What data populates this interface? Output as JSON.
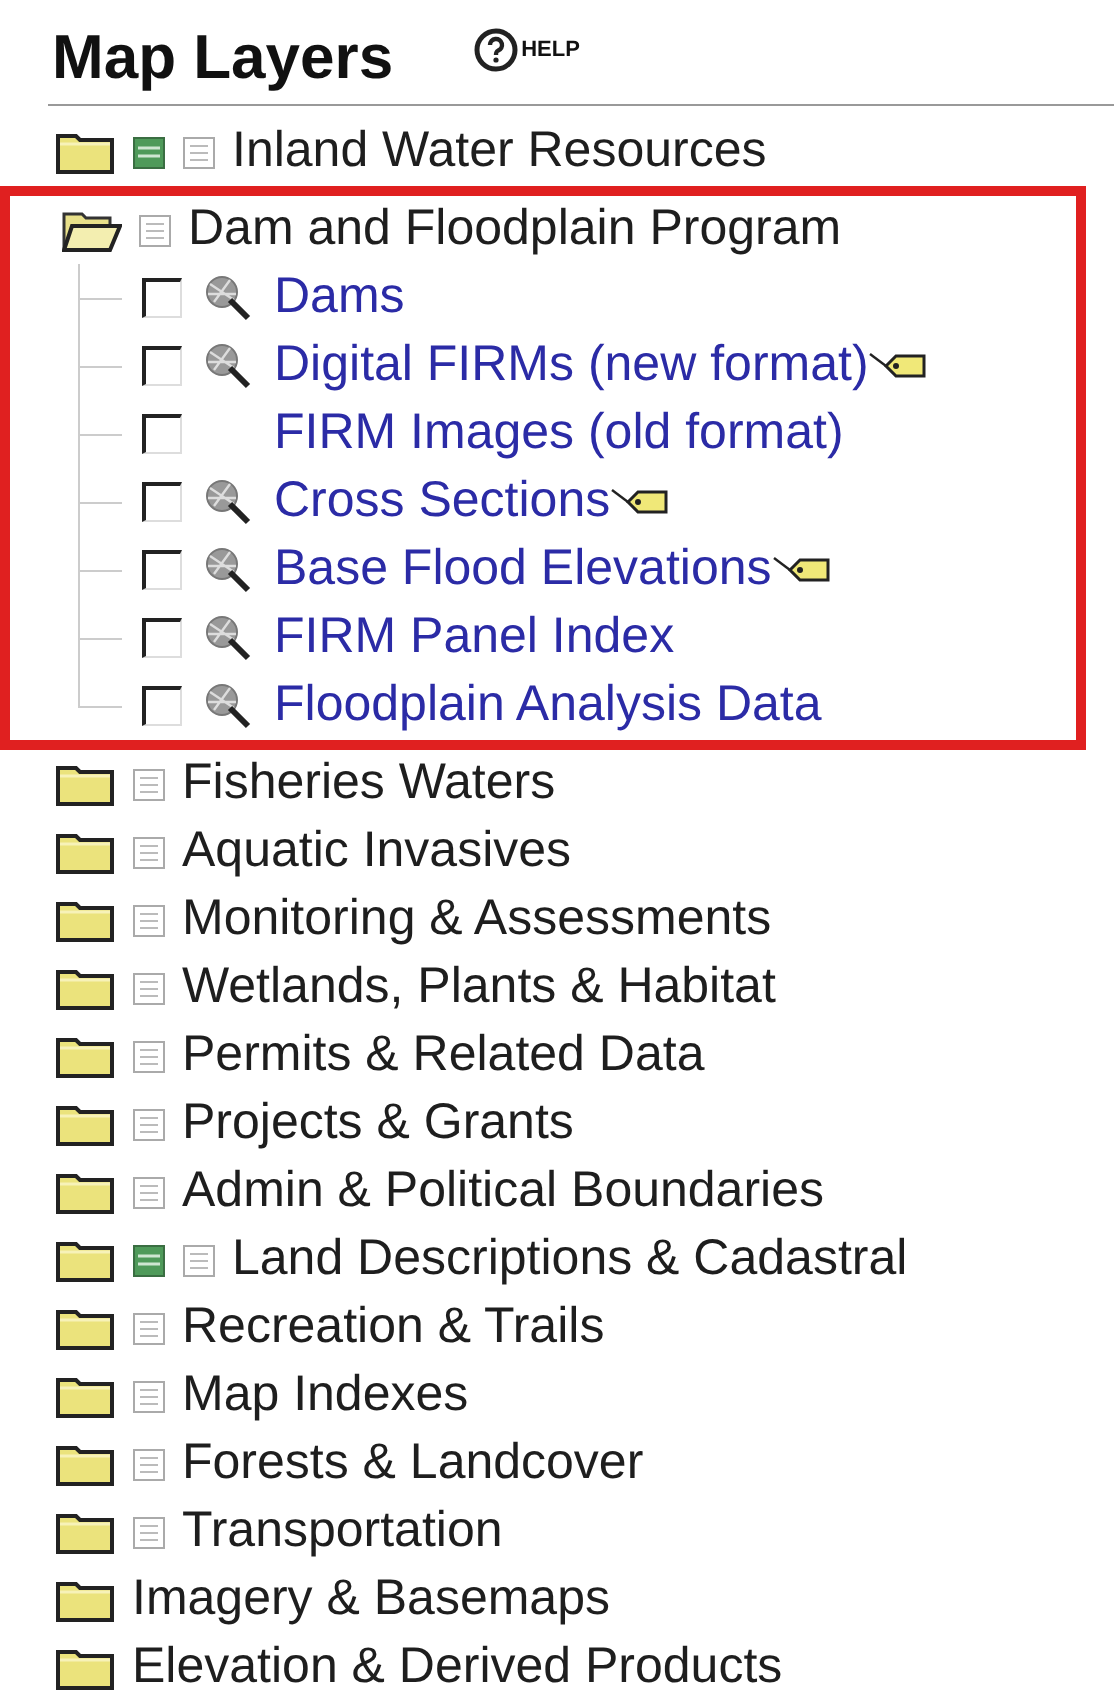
{
  "title": "Map Layers",
  "help": {
    "label": "HELP"
  },
  "layers": [
    {
      "label": "Inland Water Resources",
      "expanded": false,
      "legend": true,
      "list_icon": true
    },
    {
      "label": "Dam and Floodplain Program",
      "expanded": true,
      "legend": false,
      "list_icon": true,
      "highlighted": true,
      "children": [
        {
          "label": "Dams",
          "checked": false,
          "identify": true,
          "tag": false
        },
        {
          "label": "Digital FIRMs (new format)",
          "checked": false,
          "identify": true,
          "tag": true
        },
        {
          "label": "FIRM Images (old format)",
          "checked": false,
          "identify": false,
          "tag": false
        },
        {
          "label": "Cross Sections",
          "checked": false,
          "identify": true,
          "tag": true
        },
        {
          "label": "Base Flood Elevations",
          "checked": false,
          "identify": true,
          "tag": true
        },
        {
          "label": "FIRM Panel Index",
          "checked": false,
          "identify": true,
          "tag": false
        },
        {
          "label": "Floodplain Analysis Data",
          "checked": false,
          "identify": true,
          "tag": false
        }
      ]
    },
    {
      "label": "Fisheries Waters",
      "expanded": false,
      "legend": false,
      "list_icon": true
    },
    {
      "label": "Aquatic Invasives",
      "expanded": false,
      "legend": false,
      "list_icon": true
    },
    {
      "label": "Monitoring & Assessments",
      "expanded": false,
      "legend": false,
      "list_icon": true
    },
    {
      "label": "Wetlands, Plants & Habitat",
      "expanded": false,
      "legend": false,
      "list_icon": true
    },
    {
      "label": "Permits & Related Data",
      "expanded": false,
      "legend": false,
      "list_icon": true
    },
    {
      "label": "Projects & Grants",
      "expanded": false,
      "legend": false,
      "list_icon": true
    },
    {
      "label": "Admin & Political Boundaries",
      "expanded": false,
      "legend": false,
      "list_icon": true
    },
    {
      "label": "Land Descriptions & Cadastral",
      "expanded": false,
      "legend": true,
      "list_icon": true
    },
    {
      "label": "Recreation & Trails",
      "expanded": false,
      "legend": false,
      "list_icon": true
    },
    {
      "label": "Map Indexes",
      "expanded": false,
      "legend": false,
      "list_icon": true
    },
    {
      "label": "Forests & Landcover",
      "expanded": false,
      "legend": false,
      "list_icon": true
    },
    {
      "label": "Transportation",
      "expanded": false,
      "legend": false,
      "list_icon": true
    },
    {
      "label": "Imagery & Basemaps",
      "expanded": false,
      "legend": false,
      "list_icon": false
    },
    {
      "label": "Elevation & Derived Products",
      "expanded": false,
      "legend": false,
      "list_icon": false
    }
  ]
}
